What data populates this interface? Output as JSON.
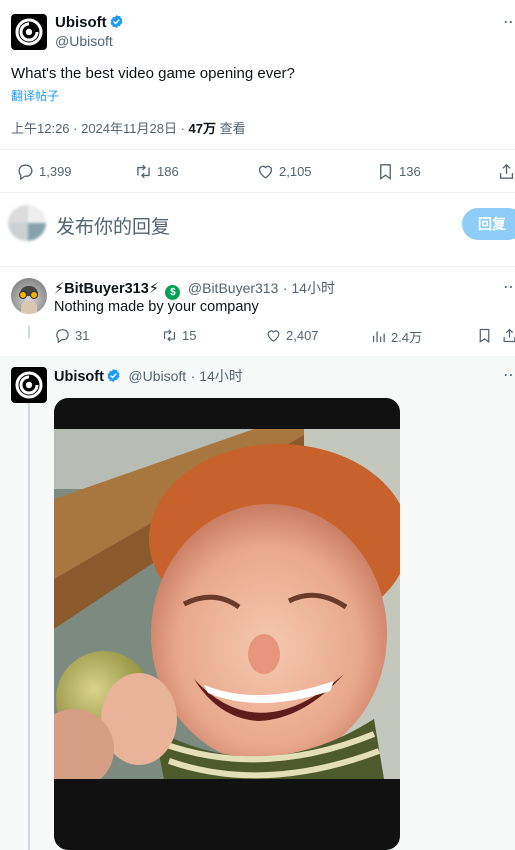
{
  "main_tweet": {
    "display_name": "Ubisoft",
    "handle": "@Ubisoft",
    "text": "What's the best video game opening ever?",
    "translate_link": "翻译帖子",
    "meta_time": "上午12:26 · 2024年11月28日 · ",
    "views_count": "47万",
    "views_label": " 查看",
    "replies": "1,399",
    "retweets": "186",
    "likes": "2,105",
    "bookmarks": "136"
  },
  "composer": {
    "placeholder": "发布你的回复",
    "reply_button": "回复"
  },
  "reply1": {
    "display_name": "⚡BitBuyer313⚡",
    "handle": "@BitBuyer313",
    "time": "· 14小时",
    "text": "Nothing made by your company",
    "replies": "31",
    "retweets": "15",
    "likes": "2,407",
    "views": "2.4万"
  },
  "reply2": {
    "display_name": "Ubisoft",
    "handle": "@Ubisoft",
    "time": "· 14小时"
  },
  "colors": {
    "accent": "#1d9bf0",
    "verified": "#1d9bf0",
    "reply_button_disabled": "#8ecdf8",
    "muted": "#536471"
  }
}
